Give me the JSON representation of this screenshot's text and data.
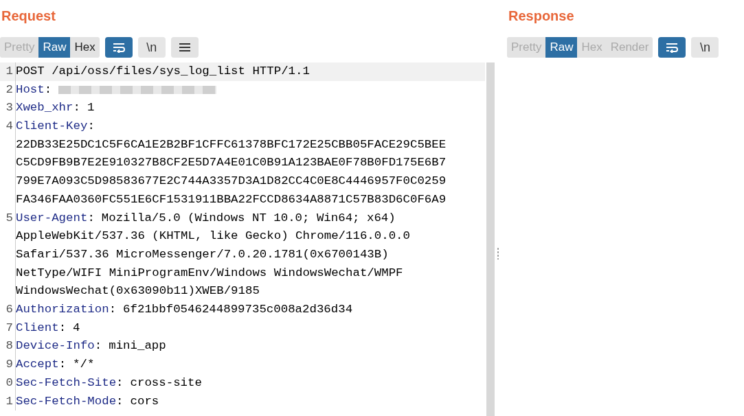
{
  "request": {
    "title": "Request",
    "tabs": [
      {
        "label": "Pretty",
        "selected": false,
        "disabled": true
      },
      {
        "label": "Raw",
        "selected": true,
        "disabled": false
      },
      {
        "label": "Hex",
        "selected": false,
        "disabled": false
      }
    ],
    "toggles": [
      {
        "kind": "wrap",
        "on": true
      },
      {
        "kind": "text",
        "label": "\\n",
        "on": false
      },
      {
        "kind": "menu",
        "on": false
      }
    ],
    "lines": [
      {
        "number": "1",
        "text": "POST /api/oss/files/sys_log_list HTTP/1.1",
        "current": true
      },
      {
        "number": "2",
        "name": "Host",
        "sep": ":",
        "redacted": true
      },
      {
        "number": "3",
        "name": "Xweb_xhr",
        "sep": ":",
        "value": "1"
      },
      {
        "number": "4",
        "name": "Client-Key",
        "sep": ":",
        "wrapped": [
          "22DB33E25DC1C5F6CA1E2B2BF1CFFC61378BFC172E25CBB05FACE29C5BEE",
          "C5CD9FB9B7E2E910327B8CF2E5D7A4E01C0B91A123BAE0F78B0FD175E6B7",
          "799E7A093C5D98583677E2C744A3357D3A1D82CC4C0E8C4446957F0C0259",
          "FA346FAA0360FC551E6CF1531911BBA22FCCD8634A8871C57B83D6C0F6A9"
        ]
      },
      {
        "number": "5",
        "name": "User-Agent",
        "sep": ":",
        "value": "Mozilla/5.0 (Windows NT 10.0; Win64; x64)",
        "wrapped": [
          "AppleWebKit/537.36 (KHTML, like Gecko) Chrome/116.0.0.0",
          "Safari/537.36 MicroMessenger/7.0.20.1781(0x6700143B)",
          "NetType/WIFI MiniProgramEnv/Windows WindowsWechat/WMPF",
          "WindowsWechat(0x63090b11)XWEB/9185"
        ]
      },
      {
        "number": "6",
        "name": "Authorization",
        "sep": ":",
        "value": "6f21bbf0546244899735c008a2d36d34"
      },
      {
        "number": "7",
        "name": "Client",
        "sep": ":",
        "value": "4"
      },
      {
        "number": "8",
        "name": "Device-Info",
        "sep": ":",
        "value": "mini_app"
      },
      {
        "number": "9",
        "name": "Accept",
        "sep": ":",
        "value": "*/*"
      },
      {
        "number": "0",
        "name": "Sec-Fetch-Site",
        "sep": ":",
        "value": "cross-site"
      },
      {
        "number": "1",
        "name": "Sec-Fetch-Mode",
        "sep": ":",
        "value": "cors"
      }
    ]
  },
  "response": {
    "title": "Response",
    "tabs": [
      {
        "label": "Pretty",
        "selected": false,
        "disabled": true
      },
      {
        "label": "Raw",
        "selected": true,
        "disabled": false
      },
      {
        "label": "Hex",
        "selected": false,
        "disabled": true
      },
      {
        "label": "Render",
        "selected": false,
        "disabled": true
      }
    ],
    "toggles": [
      {
        "kind": "wrap",
        "on": true
      },
      {
        "kind": "text",
        "label": "\\n",
        "on": false
      }
    ]
  }
}
